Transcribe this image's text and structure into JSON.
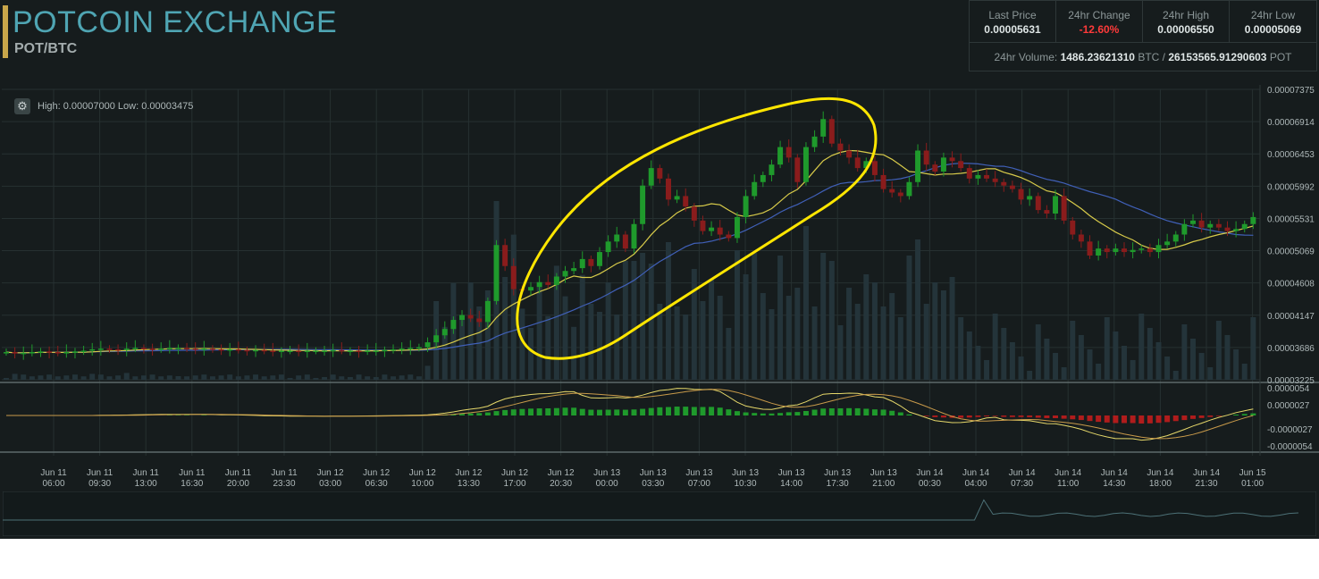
{
  "header": {
    "title": "POTCOIN EXCHANGE",
    "pair": "POT/BTC"
  },
  "stats": {
    "last_price": {
      "label": "Last Price",
      "value": "0.00005631"
    },
    "change_24h": {
      "label": "24hr Change",
      "value": "-12.60%"
    },
    "high_24h": {
      "label": "24hr High",
      "value": "0.00006550"
    },
    "low_24h": {
      "label": "24hr Low",
      "value": "0.00005069"
    },
    "volume": {
      "label": "24hr Volume:",
      "btc": "1486.23621310",
      "btc_unit": "BTC",
      "separator": "/",
      "pot": "26153565.91290603",
      "pot_unit": "POT"
    }
  },
  "chart_toolbar": {
    "settings_icon": "gear-icon",
    "high_low_text": "High: 0.00007000  Low: 0.00003475"
  },
  "colors": {
    "background": "#161c1d",
    "title": "#4fa5b3",
    "accent_bar": "#c8a64a",
    "up": "#1f9a2c",
    "down": "#8a1c1c",
    "ma_fast": "#d8cb4a",
    "ma_slow": "#4060b8",
    "change_negative": "#ff3a3a",
    "annotation": "#ffe600"
  },
  "chart_data": {
    "type": "candlestick",
    "price_axis": [
      "0.00007375",
      "0.00006914",
      "0.00006453",
      "0.00005992",
      "0.00005531",
      "0.00005069",
      "0.00004608",
      "0.00004147",
      "0.00003686",
      "0.00003225"
    ],
    "macd_axis": [
      "0.0000054",
      "0.0000027",
      "-0.0000027",
      "-0.0000054"
    ],
    "time_labels": [
      [
        "Jun 11",
        "06:00"
      ],
      [
        "Jun 11",
        "09:30"
      ],
      [
        "Jun 11",
        "13:00"
      ],
      [
        "Jun 11",
        "16:30"
      ],
      [
        "Jun 11",
        "20:00"
      ],
      [
        "Jun 11",
        "23:30"
      ],
      [
        "Jun 12",
        "03:00"
      ],
      [
        "Jun 12",
        "06:30"
      ],
      [
        "Jun 12",
        "10:00"
      ],
      [
        "Jun 12",
        "13:30"
      ],
      [
        "Jun 12",
        "17:00"
      ],
      [
        "Jun 12",
        "20:30"
      ],
      [
        "Jun 13",
        "00:00"
      ],
      [
        "Jun 13",
        "03:30"
      ],
      [
        "Jun 13",
        "07:00"
      ],
      [
        "Jun 13",
        "10:30"
      ],
      [
        "Jun 13",
        "14:00"
      ],
      [
        "Jun 13",
        "17:30"
      ],
      [
        "Jun 13",
        "21:00"
      ],
      [
        "Jun 14",
        "00:30"
      ],
      [
        "Jun 14",
        "04:00"
      ],
      [
        "Jun 14",
        "07:30"
      ],
      [
        "Jun 14",
        "11:00"
      ],
      [
        "Jun 14",
        "14:30"
      ],
      [
        "Jun 14",
        "18:00"
      ],
      [
        "Jun 14",
        "21:30"
      ],
      [
        "Jun 15",
        "01:00"
      ]
    ],
    "price_range": [
      3.225e-05,
      7.375e-05
    ],
    "close_series": [
      3.62,
      3.6,
      3.61,
      3.62,
      3.63,
      3.62,
      3.61,
      3.62,
      3.63,
      3.64,
      3.66,
      3.67,
      3.66,
      3.65,
      3.67,
      3.68,
      3.67,
      3.66,
      3.67,
      3.68,
      3.68,
      3.67,
      3.66,
      3.67,
      3.66,
      3.65,
      3.66,
      3.65,
      3.64,
      3.65,
      3.64,
      3.63,
      3.64,
      3.64,
      3.63,
      3.64,
      3.64,
      3.64,
      3.65,
      3.64,
      3.64,
      3.63,
      3.64,
      3.64,
      3.65,
      3.66,
      3.67,
      3.68,
      3.69,
      3.76,
      3.86,
      3.95,
      4.08,
      4.15,
      4.1,
      4.05,
      4.35,
      5.15,
      4.85,
      4.52,
      4.5,
      4.55,
      4.62,
      4.58,
      4.7,
      4.78,
      4.82,
      4.95,
      4.85,
      5.05,
      5.2,
      5.3,
      5.1,
      5.45,
      6.0,
      6.25,
      6.1,
      5.8,
      5.85,
      5.7,
      5.5,
      5.35,
      5.4,
      5.3,
      5.25,
      5.55,
      5.85,
      6.05,
      6.15,
      6.3,
      6.55,
      6.4,
      6.05,
      6.55,
      6.7,
      6.95,
      6.6,
      6.5,
      6.4,
      6.25,
      6.35,
      6.15,
      5.95,
      5.9,
      5.85,
      6.05,
      6.5,
      6.3,
      6.2,
      6.4,
      6.35,
      6.25,
      6.1,
      6.15,
      6.1,
      6.05,
      6.0,
      5.95,
      5.8,
      5.85,
      5.65,
      5.6,
      5.85,
      5.5,
      5.3,
      5.2,
      5.0,
      5.1,
      5.05,
      5.1,
      5.05,
      5.08,
      5.1,
      5.05,
      5.15,
      5.2,
      5.3,
      5.45,
      5.5,
      5.4,
      5.45,
      5.4,
      5.35,
      5.38,
      5.45,
      5.55
    ],
    "series": [
      {
        "name": "MA fast",
        "color": "#d8cb4a"
      },
      {
        "name": "MA slow",
        "color": "#4060b8"
      }
    ]
  },
  "annotation": {
    "type": "hand-drawn ellipse",
    "color": "#ffe600"
  }
}
